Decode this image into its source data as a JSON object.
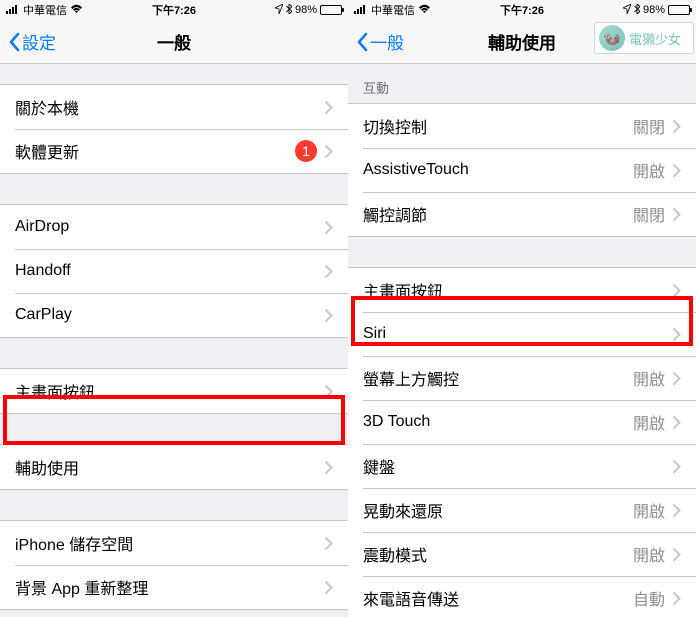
{
  "status": {
    "carrier": "中華電信",
    "time": "下午7:26",
    "battery": "98%"
  },
  "left": {
    "back": "設定",
    "title": "一般",
    "groups": [
      [
        {
          "label": "關於本機"
        },
        {
          "label": "軟體更新",
          "badge": "1"
        }
      ],
      [
        {
          "label": "AirDrop"
        },
        {
          "label": "Handoff"
        },
        {
          "label": "CarPlay"
        }
      ],
      [
        {
          "label": "主畫面按鈕"
        }
      ],
      [
        {
          "label": "輔助使用"
        }
      ],
      [
        {
          "label": "iPhone 儲存空間"
        },
        {
          "label": "背景 App 重新整理"
        }
      ]
    ]
  },
  "right": {
    "back": "一般",
    "title": "輔助使用",
    "section_header": "互動",
    "groups": [
      [
        {
          "label": "切換控制",
          "value": "關閉"
        },
        {
          "label": "AssistiveTouch",
          "value": "開啟"
        },
        {
          "label": "觸控調節",
          "value": "關閉"
        }
      ],
      [
        {
          "label": "主畫面按鈕"
        },
        {
          "label": "Siri"
        },
        {
          "label": "螢幕上方觸控",
          "value": "開啟"
        },
        {
          "label": "3D Touch",
          "value": "開啟"
        },
        {
          "label": "鍵盤"
        },
        {
          "label": "晃動來還原",
          "value": "開啟"
        },
        {
          "label": "震動模式",
          "value": "開啟"
        },
        {
          "label": "來電語音傳送",
          "value": "自動"
        }
      ]
    ]
  },
  "watermark": "電獺少女"
}
